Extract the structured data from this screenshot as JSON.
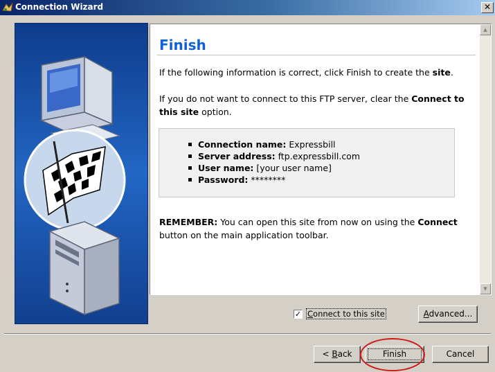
{
  "window": {
    "title": "Connection Wizard",
    "close_glyph": "✕"
  },
  "icons": {
    "window": "wizard-icon",
    "close": "close-icon",
    "side": [
      "monitor-icon",
      "checkered-flag-icon",
      "computer-tower-icon"
    ]
  },
  "page": {
    "heading": "Finish",
    "para1_pre": "If the following information is correct, click Finish to create the ",
    "para1_bold": "site",
    "para1_post": ".",
    "para2_pre": "If you do not want to connect to this FTP server, clear the ",
    "para2_bold": "Connect to this site",
    "para2_post": " option.",
    "details": [
      {
        "label": "Connection name:",
        "value": " Expressbill"
      },
      {
        "label": "Server address:",
        "value": " ftp.expressbill.com"
      },
      {
        "label": "User name:",
        "value": " [your user name]"
      },
      {
        "label": "Password:",
        "value": " ********"
      }
    ],
    "remember_label": "REMEMBER:",
    "remember_mid": " You can open this site from now on using the ",
    "remember_bold": "Connect",
    "remember_post": " button on the main application toolbar."
  },
  "options": {
    "connect_checked": true,
    "connect_mark": "✓",
    "connect_label_ul": "C",
    "connect_label_rest": "onnect to this site"
  },
  "buttons": {
    "advanced_ul": "A",
    "advanced_rest": "dvanced...",
    "back_prefix": "< ",
    "back_ul": "B",
    "back_rest": "ack",
    "finish": "Finish",
    "cancel": "Cancel"
  },
  "colors": {
    "heading": "#1060d8",
    "annotation": "#d01818",
    "side_panel": "#1b54b0"
  }
}
